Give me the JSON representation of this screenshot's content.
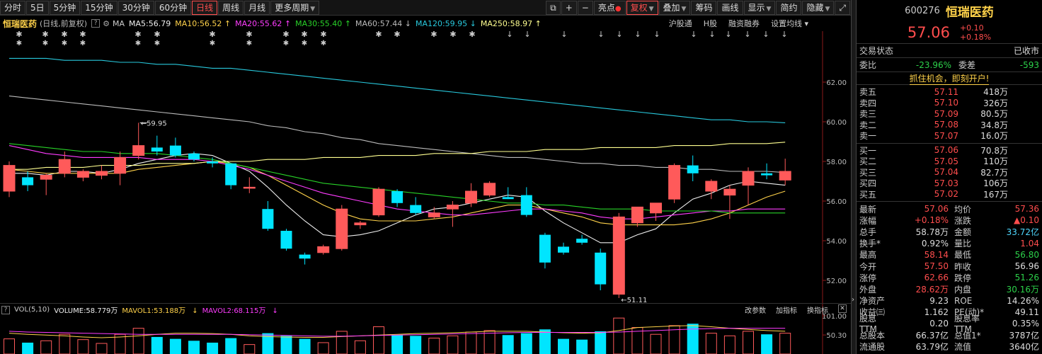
{
  "toolbar": {
    "periods": [
      "分时",
      "5日",
      "5分钟",
      "15分钟",
      "30分钟",
      "60分钟",
      "日线",
      "周线",
      "月线",
      "更多周期"
    ],
    "active_period": "日线",
    "right_buttons": [
      "亮点",
      "复权",
      "叠加",
      "筹码",
      "画线",
      "显示",
      "简约",
      "隐藏"
    ]
  },
  "infobar": {
    "stock_name": "恒瑞医药",
    "sub": "(日线,前复权)",
    "ma_label": "MA",
    "ma5": "MA5:56.79",
    "ma10": "MA10:56.52",
    "ma20": "MA20:55.62",
    "ma30": "MA30:55.40",
    "ma60": "MA60:57.44",
    "ma120": "MA120:59.95",
    "ma250": "MA250:58.97",
    "links": [
      "沪股通",
      "H股",
      "融资融券",
      "设置均线"
    ]
  },
  "chart_data": {
    "type": "candlestick",
    "ylim": [
      51,
      64
    ],
    "y_ticks": [
      "62.00",
      "60.00",
      "58.00",
      "56.00",
      "54.00",
      "52.00"
    ],
    "high_annotation": "59.95",
    "low_annotation": "51.11",
    "candles": [
      {
        "o": 56.5,
        "h": 58.0,
        "l": 56.2,
        "c": 57.8
      },
      {
        "o": 57.2,
        "h": 57.5,
        "l": 56.5,
        "c": 56.8
      },
      {
        "o": 57.1,
        "h": 57.4,
        "l": 56.3,
        "c": 57.3
      },
      {
        "o": 57.4,
        "h": 58.5,
        "l": 57.2,
        "c": 58.1
      },
      {
        "o": 57.2,
        "h": 57.6,
        "l": 57.0,
        "c": 57.5
      },
      {
        "o": 57.3,
        "h": 57.8,
        "l": 57.1,
        "c": 57.5
      },
      {
        "o": 57.4,
        "h": 58.5,
        "l": 56.8,
        "c": 58.2
      },
      {
        "o": 58.3,
        "h": 59.95,
        "l": 58.1,
        "c": 58.8
      },
      {
        "o": 58.7,
        "h": 59.3,
        "l": 58.3,
        "c": 58.5
      },
      {
        "o": 58.8,
        "h": 59.2,
        "l": 58.2,
        "c": 58.3
      },
      {
        "o": 58.4,
        "h": 58.5,
        "l": 58.0,
        "c": 58.1
      },
      {
        "o": 58.0,
        "h": 58.2,
        "l": 57.7,
        "c": 57.9
      },
      {
        "o": 57.9,
        "h": 57.9,
        "l": 56.6,
        "c": 56.8
      },
      {
        "o": 56.7,
        "h": 57.2,
        "l": 56.4,
        "c": 56.7
      },
      {
        "o": 55.6,
        "h": 56.0,
        "l": 54.5,
        "c": 54.6
      },
      {
        "o": 54.5,
        "h": 54.6,
        "l": 53.5,
        "c": 53.6
      },
      {
        "o": 53.3,
        "h": 53.4,
        "l": 52.8,
        "c": 53.1
      },
      {
        "o": 53.4,
        "h": 53.8,
        "l": 53.3,
        "c": 53.7
      },
      {
        "o": 53.6,
        "h": 55.8,
        "l": 53.5,
        "c": 55.6
      },
      {
        "o": 54.8,
        "h": 55.0,
        "l": 54.6,
        "c": 54.9
      },
      {
        "o": 55.3,
        "h": 56.7,
        "l": 55.2,
        "c": 56.6
      },
      {
        "o": 56.5,
        "h": 56.6,
        "l": 55.7,
        "c": 55.9
      },
      {
        "o": 55.8,
        "h": 56.2,
        "l": 55.3,
        "c": 55.4
      },
      {
        "o": 55.2,
        "h": 55.7,
        "l": 55.1,
        "c": 55.4
      },
      {
        "o": 55.6,
        "h": 56.0,
        "l": 54.7,
        "c": 55.8
      },
      {
        "o": 55.9,
        "h": 56.9,
        "l": 55.7,
        "c": 56.5
      },
      {
        "o": 56.3,
        "h": 57.0,
        "l": 56.2,
        "c": 56.9
      },
      {
        "o": 56.2,
        "h": 56.7,
        "l": 56.1,
        "c": 56.1
      },
      {
        "o": 56.3,
        "h": 56.7,
        "l": 55.2,
        "c": 55.3
      },
      {
        "o": 54.3,
        "h": 54.4,
        "l": 52.6,
        "c": 52.9
      },
      {
        "o": 53.7,
        "h": 53.9,
        "l": 53.3,
        "c": 53.4
      },
      {
        "o": 54.1,
        "h": 54.3,
        "l": 53.8,
        "c": 53.9
      },
      {
        "o": 53.4,
        "h": 53.6,
        "l": 51.5,
        "c": 51.8
      },
      {
        "o": 51.3,
        "h": 55.4,
        "l": 51.11,
        "c": 55.2
      },
      {
        "o": 54.9,
        "h": 55.7,
        "l": 54.7,
        "c": 55.7
      },
      {
        "o": 55.4,
        "h": 55.9,
        "l": 55.0,
        "c": 55.9
      },
      {
        "o": 56.1,
        "h": 57.9,
        "l": 55.9,
        "c": 57.8
      },
      {
        "o": 57.8,
        "h": 58.3,
        "l": 57.0,
        "c": 57.4
      },
      {
        "o": 56.5,
        "h": 57.1,
        "l": 56.1,
        "c": 57.0
      },
      {
        "o": 56.3,
        "h": 56.8,
        "l": 55.1,
        "c": 56.6
      },
      {
        "o": 56.8,
        "h": 57.7,
        "l": 55.8,
        "c": 57.5
      },
      {
        "o": 57.4,
        "h": 57.9,
        "l": 57.1,
        "c": 57.3
      },
      {
        "o": 57.06,
        "h": 58.14,
        "l": 56.8,
        "c": 57.5
      }
    ],
    "ma_lines": [
      {
        "name": "MA5",
        "color": "#eeeeee",
        "values": [
          57.4,
          57.4,
          57.3,
          57.5,
          57.5,
          57.4,
          57.6,
          57.9,
          58.1,
          58.3,
          58.4,
          58.3,
          57.9,
          57.5,
          56.7,
          55.8,
          55.0,
          54.3,
          54.2,
          54.3,
          54.5,
          54.9,
          55.3,
          55.6,
          55.7,
          55.9,
          56.1,
          56.3,
          56.2,
          55.5,
          54.9,
          54.4,
          53.9,
          53.9,
          54.3,
          54.6,
          55.4,
          56.1,
          56.4,
          56.8,
          57.0,
          56.9,
          56.8
        ]
      },
      {
        "name": "MA10",
        "color": "#ffd24a",
        "values": [
          57.6,
          57.5,
          57.4,
          57.4,
          57.4,
          57.4,
          57.4,
          57.6,
          57.7,
          57.8,
          57.9,
          58.0,
          57.9,
          57.7,
          57.3,
          56.8,
          56.3,
          55.8,
          55.4,
          55.1,
          55.0,
          55.0,
          55.0,
          55.1,
          55.2,
          55.4,
          55.6,
          55.8,
          55.8,
          55.6,
          55.4,
          55.2,
          54.9,
          54.8,
          54.8,
          54.8,
          54.8,
          54.9,
          55.1,
          55.4,
          55.8,
          56.2,
          56.5
        ]
      },
      {
        "name": "MA20",
        "color": "#ff3cff",
        "values": [
          58.8,
          58.6,
          58.4,
          58.3,
          58.2,
          58.2,
          58.2,
          58.2,
          58.1,
          58.1,
          58.1,
          58.0,
          57.8,
          57.6,
          57.3,
          57.0,
          56.7,
          56.4,
          56.2,
          56.0,
          55.8,
          55.6,
          55.5,
          55.4,
          55.3,
          55.3,
          55.4,
          55.5,
          55.6,
          55.6,
          55.5,
          55.4,
          55.2,
          55.1,
          55.1,
          55.2,
          55.3,
          55.4,
          55.5,
          55.5,
          55.6,
          55.6,
          55.6
        ]
      },
      {
        "name": "MA30",
        "color": "#28d228",
        "values": [
          58.9,
          58.8,
          58.7,
          58.6,
          58.5,
          58.5,
          58.4,
          58.4,
          58.4,
          58.3,
          58.2,
          58.1,
          57.9,
          57.7,
          57.5,
          57.3,
          57.1,
          56.9,
          56.8,
          56.7,
          56.6,
          56.5,
          56.4,
          56.3,
          56.2,
          56.1,
          56.0,
          55.9,
          55.9,
          55.8,
          55.8,
          55.7,
          55.6,
          55.6,
          55.6,
          55.5,
          55.5,
          55.5,
          55.5,
          55.4,
          55.4,
          55.4,
          55.4
        ]
      },
      {
        "name": "MA60",
        "color": "#bbbbbb",
        "values": [
          61.3,
          61.2,
          61.1,
          61.0,
          60.9,
          60.8,
          60.7,
          60.6,
          60.5,
          60.4,
          60.3,
          60.2,
          60.1,
          60.0,
          59.8,
          59.7,
          59.5,
          59.4,
          59.2,
          59.1,
          58.9,
          58.8,
          58.7,
          58.6,
          58.5,
          58.4,
          58.3,
          58.2,
          58.2,
          58.1,
          58.0,
          57.9,
          57.9,
          57.8,
          57.8,
          57.7,
          57.7,
          57.6,
          57.6,
          57.5,
          57.5,
          57.5,
          57.44
        ]
      },
      {
        "name": "MA120",
        "color": "#28c8dc",
        "values": [
          63.2,
          63.2,
          63.2,
          63.1,
          63.1,
          63.1,
          63.0,
          63.0,
          62.9,
          62.9,
          62.8,
          62.7,
          62.7,
          62.6,
          62.5,
          62.4,
          62.3,
          62.2,
          62.1,
          62.0,
          61.9,
          61.8,
          61.7,
          61.6,
          61.5,
          61.4,
          61.3,
          61.2,
          61.1,
          61.0,
          60.9,
          60.8,
          60.7,
          60.6,
          60.5,
          60.4,
          60.3,
          60.2,
          60.1,
          60.1,
          60.0,
          60.0,
          59.95
        ]
      },
      {
        "name": "MA250",
        "color": "#ffff90",
        "values": [
          57.6,
          57.6,
          57.7,
          57.7,
          57.7,
          57.8,
          57.8,
          57.8,
          57.9,
          57.9,
          57.9,
          58.0,
          58.0,
          58.0,
          58.1,
          58.1,
          58.1,
          58.2,
          58.2,
          58.2,
          58.3,
          58.3,
          58.3,
          58.4,
          58.4,
          58.4,
          58.5,
          58.5,
          58.5,
          58.6,
          58.6,
          58.6,
          58.7,
          58.7,
          58.7,
          58.7,
          58.8,
          58.8,
          58.8,
          58.9,
          58.9,
          58.9,
          58.97
        ]
      }
    ],
    "volume": {
      "ylim": [
        0,
        101
      ],
      "y_ticks": [
        "101.00",
        "50.30"
      ],
      "values": [
        40,
        30,
        35,
        52,
        38,
        28,
        52,
        68,
        45,
        40,
        35,
        30,
        42,
        25,
        55,
        48,
        40,
        30,
        60,
        35,
        72,
        50,
        48,
        42,
        48,
        58,
        62,
        50,
        55,
        65,
        40,
        38,
        60,
        95,
        70,
        52,
        75,
        80,
        55,
        48,
        60,
        52,
        55
      ],
      "vol_ma5": [
        55,
        52,
        50,
        48,
        45,
        43,
        45,
        48,
        52,
        55,
        55,
        54,
        52,
        48,
        46,
        45,
        44,
        44,
        46,
        48,
        50,
        52,
        54,
        55,
        56,
        58,
        60,
        60,
        60,
        58,
        56,
        55,
        56,
        62,
        70,
        72,
        74,
        75,
        72,
        68,
        65,
        62,
        60
      ],
      "vol_ma10": [
        60,
        58,
        57,
        56,
        55,
        54,
        53,
        52,
        52,
        52,
        52,
        52,
        52,
        51,
        50,
        49,
        48,
        47,
        47,
        48,
        49,
        50,
        51,
        52,
        53,
        54,
        55,
        56,
        57,
        57,
        57,
        57,
        57,
        58,
        60,
        62,
        64,
        66,
        67,
        68,
        68,
        68,
        68
      ]
    }
  },
  "markers_count": 16,
  "volbar": {
    "label": "VOL(5,10)",
    "volume": "VOLUME:58.779万",
    "mavol1": "MAVOL1:53.188万",
    "mavol2": "MAVOL2:68.115万",
    "links": [
      "改参数",
      "加指标",
      "换指标"
    ]
  },
  "panel": {
    "code": "600276",
    "name": "恒瑞医药",
    "price": "57.06",
    "change": "+0.10",
    "change_pct": "+0.18%",
    "status_label": "交易状态",
    "status_value": "已收市",
    "weibi_label": "委比",
    "weibi_value": "-23.96%",
    "weicha_label": "委差",
    "weicha_value": "-593",
    "ad": "抓住机会，即刻开户!",
    "asks": [
      {
        "label": "卖五",
        "price": "57.11",
        "vol": "418万"
      },
      {
        "label": "卖四",
        "price": "57.10",
        "vol": "326万"
      },
      {
        "label": "卖三",
        "price": "57.09",
        "vol": "80.5万"
      },
      {
        "label": "卖二",
        "price": "57.08",
        "vol": "34.8万"
      },
      {
        "label": "卖一",
        "price": "57.07",
        "vol": "16.0万"
      }
    ],
    "bids": [
      {
        "label": "买一",
        "price": "57.06",
        "vol": "70.8万"
      },
      {
        "label": "买二",
        "price": "57.05",
        "vol": "110万"
      },
      {
        "label": "买三",
        "price": "57.04",
        "vol": "82.7万"
      },
      {
        "label": "买四",
        "price": "57.03",
        "vol": "106万"
      },
      {
        "label": "买五",
        "price": "57.02",
        "vol": "167万"
      }
    ],
    "stats": [
      {
        "a": "最新",
        "b": "57.06",
        "bc": "red",
        "c": "均价",
        "d": "57.36",
        "dc": "red"
      },
      {
        "a": "涨幅",
        "b": "+0.18%",
        "bc": "red",
        "c": "涨跌",
        "d": "▲0.10",
        "dc": "red"
      },
      {
        "a": "总手",
        "b": "58.78万",
        "bc": "white",
        "c": "金额",
        "d": "33.72亿",
        "dc": "cyan"
      },
      {
        "a": "换手*",
        "b": "0.92%",
        "bc": "white",
        "c": "量比",
        "d": "1.04",
        "dc": "red"
      },
      {
        "a": "最高",
        "b": "58.14",
        "bc": "red",
        "c": "最低",
        "d": "56.80",
        "dc": "green"
      },
      {
        "a": "今开",
        "b": "57.50",
        "bc": "red",
        "c": "昨收",
        "d": "56.96",
        "dc": "white"
      },
      {
        "a": "涨停",
        "b": "62.66",
        "bc": "red",
        "c": "跌停",
        "d": "51.26",
        "dc": "green"
      },
      {
        "a": "外盘",
        "b": "28.62万",
        "bc": "red",
        "c": "内盘",
        "d": "30.16万",
        "dc": "green"
      },
      {
        "a": "净资产",
        "b": "9.23",
        "bc": "white",
        "c": "ROE",
        "d": "14.26%",
        "dc": "white"
      },
      {
        "a": "收益㈢",
        "b": "1.162",
        "bc": "white",
        "c": "PE(动)*",
        "d": "49.11",
        "dc": "white"
      },
      {
        "a": "股息TTM",
        "b": "0.20",
        "bc": "white",
        "c": "股息率TTM",
        "d": "0.35%",
        "dc": "white"
      },
      {
        "a": "总股本",
        "b": "66.37亿",
        "bc": "white",
        "c": "总值1*",
        "d": "3787亿",
        "dc": "white"
      },
      {
        "a": "流通股",
        "b": "63.79亿",
        "bc": "white",
        "c": "流值",
        "d": "3640亿",
        "dc": "white"
      }
    ]
  }
}
